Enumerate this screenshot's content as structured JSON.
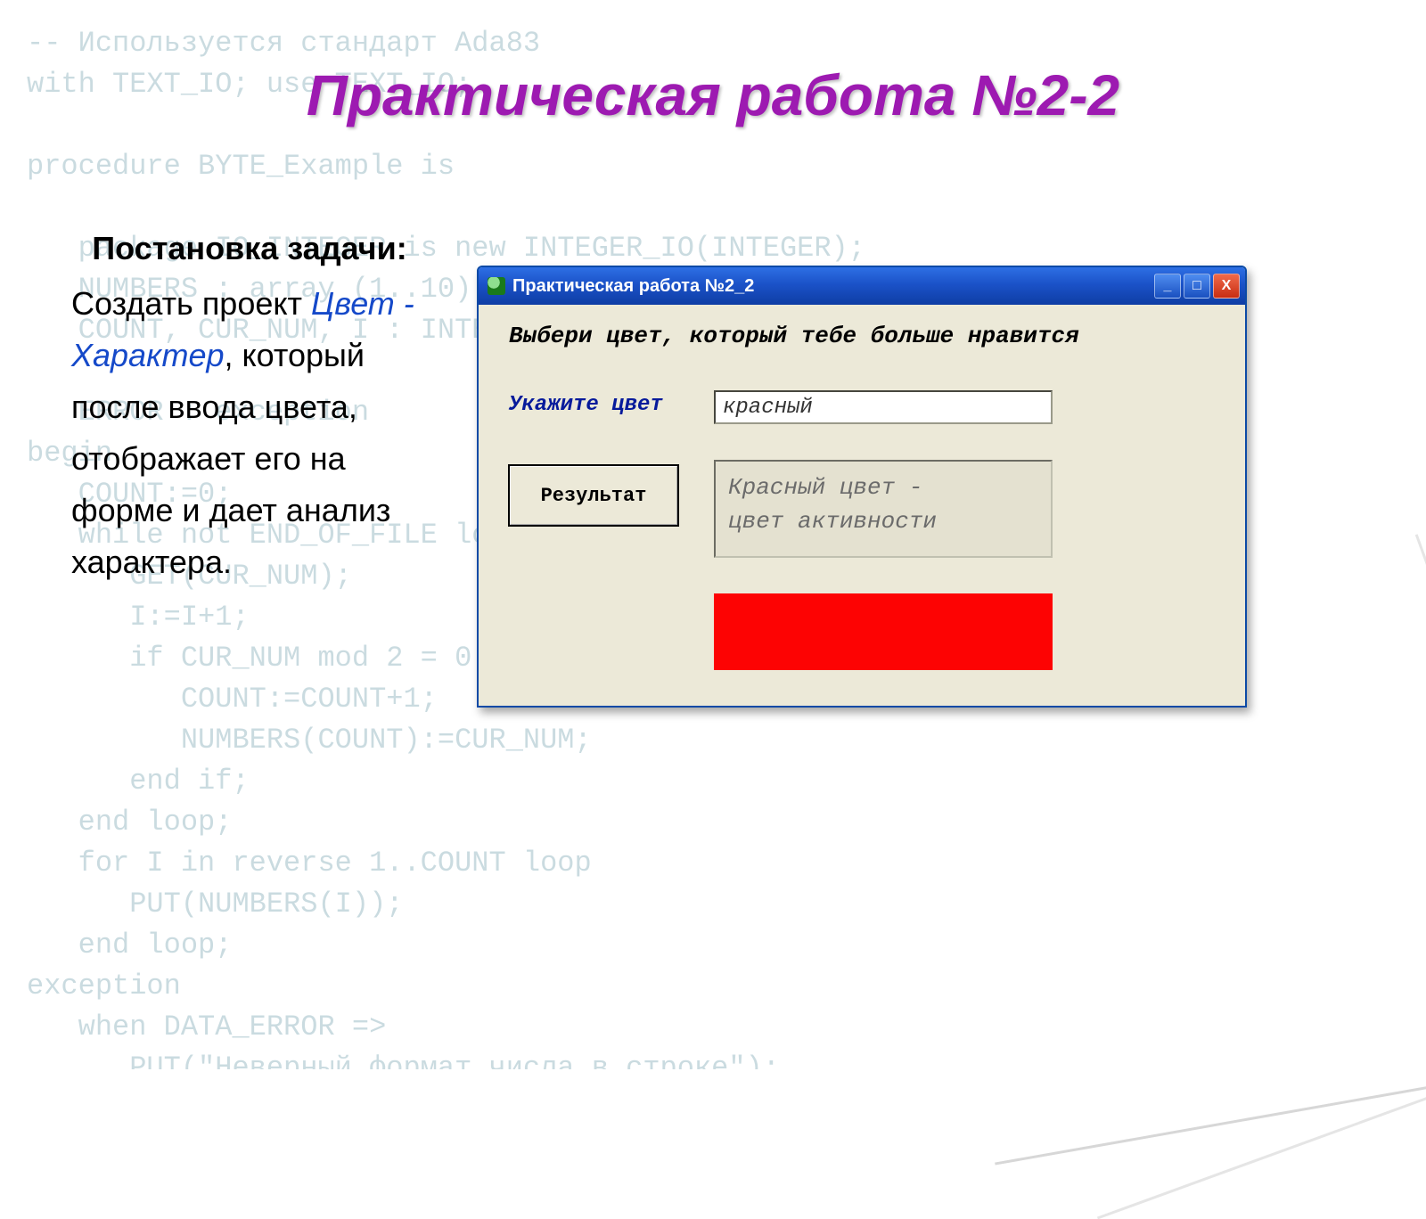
{
  "bg_code": "-- Используется стандарт Ada83\nwith TEXT_IO; use TEXT_IO;\n\nprocedure BYTE_Example is\n\n   package IO_INTEGER is new INTEGER_IO(INTEGER);\n   NUMBERS : array (1..10) of INTEGER;\n   COUNT, CUR_NUM, I : INTEGER;\n\n   ERROR : exception\nbegin\n   COUNT:=0;\n   while not END_OF_FILE loop\n      GET(CUR_NUM);\n      I:=I+1;\n      if CUR_NUM mod 2 = 0 then\n         COUNT:=COUNT+1;\n         NUMBERS(COUNT):=CUR_NUM;\n      end if;\n   end loop;\n   for I in reverse 1..COUNT loop\n      PUT(NUMBERS(I));\n   end loop;\nexception\n   when DATA_ERROR =>\n      PUT(\"Неверный формат числа в строке\");\n      raise ERROR;\nend BYTE_Example;",
  "slide": {
    "title": "Практическая работа №2-2"
  },
  "task": {
    "heading": "Постановка задачи:",
    "body_pre": "Создать проект ",
    "body_em": "Цвет - Характер",
    "body_post": ", который после ввода цвета, отображает его на форме и дает анализ характера."
  },
  "window": {
    "title": "Практическая работа №2_2",
    "buttons": {
      "min": "_",
      "max": "□",
      "close": "X"
    },
    "prompt": "Выбери цвет, который тебе больше нравится",
    "field_label": "Укажите цвет",
    "field_value": "красный",
    "result_button": "Результат",
    "result_text": "Красный цвет -\nцвет активности",
    "swatch_color": "#fd0303"
  }
}
